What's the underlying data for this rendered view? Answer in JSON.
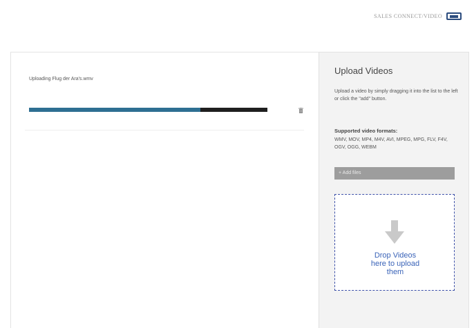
{
  "header": {
    "brand_text": "SALES CONNECT/VIDEO",
    "brand_icon": "link-logo-icon"
  },
  "uploads": [
    {
      "filename_label": "Uploading Flug der Ara's.wmv",
      "progress": 0.72
    }
  ],
  "sidebar": {
    "title": "Upload Videos",
    "description": "Upload a video by simply dragging it into the list to the left or click the \"add\" button.",
    "formats_title": "Supported video formats:",
    "formats_list": "WMV, MOV, MP4, M4V, AVI, MPEG, MPG, FLV, F4V, OGV, OGG, WEBM",
    "add_button_label": "+ Add files",
    "drop_zone_text": "Drop Videos\nhere to upload\nthem"
  },
  "colors": {
    "progress_fill": "#2e6f92",
    "progress_track": "#1f1f1f",
    "drop_zone_border": "#3b4fa8",
    "drop_zone_text": "#3a63b8",
    "add_button_bg": "#9d9d9d"
  }
}
